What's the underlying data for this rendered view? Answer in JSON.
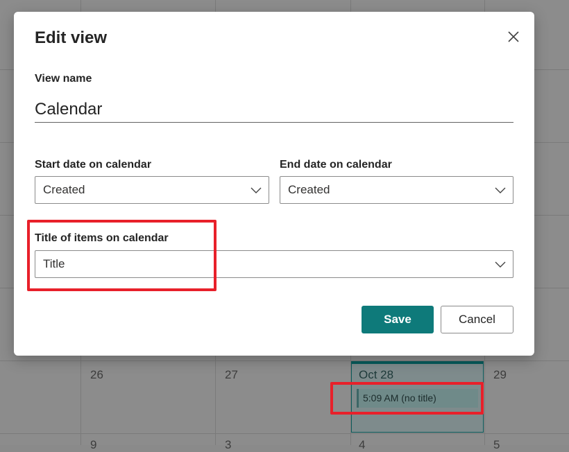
{
  "dialog": {
    "title": "Edit view",
    "view_name_label": "View name",
    "view_name_value": "Calendar",
    "start_date_label": "Start date on calendar",
    "start_date_value": "Created",
    "end_date_label": "End date on calendar",
    "end_date_value": "Created",
    "title_items_label": "Title of items on calendar",
    "title_items_value": "Title",
    "save_label": "Save",
    "cancel_label": "Cancel",
    "close_icon": "close-icon",
    "chevron_icon": "chevron-down-icon"
  },
  "calendar": {
    "days": [
      "26",
      "27",
      "29"
    ],
    "bottom_days": [
      "9",
      "3",
      "4",
      "5"
    ],
    "today_label": "Oct 28",
    "event_time": "5:09 AM",
    "event_title": "(no title)"
  },
  "colors": {
    "accent": "#0e7a7a",
    "annotation": "#e8202a",
    "overlay": "#8a8a8a"
  }
}
